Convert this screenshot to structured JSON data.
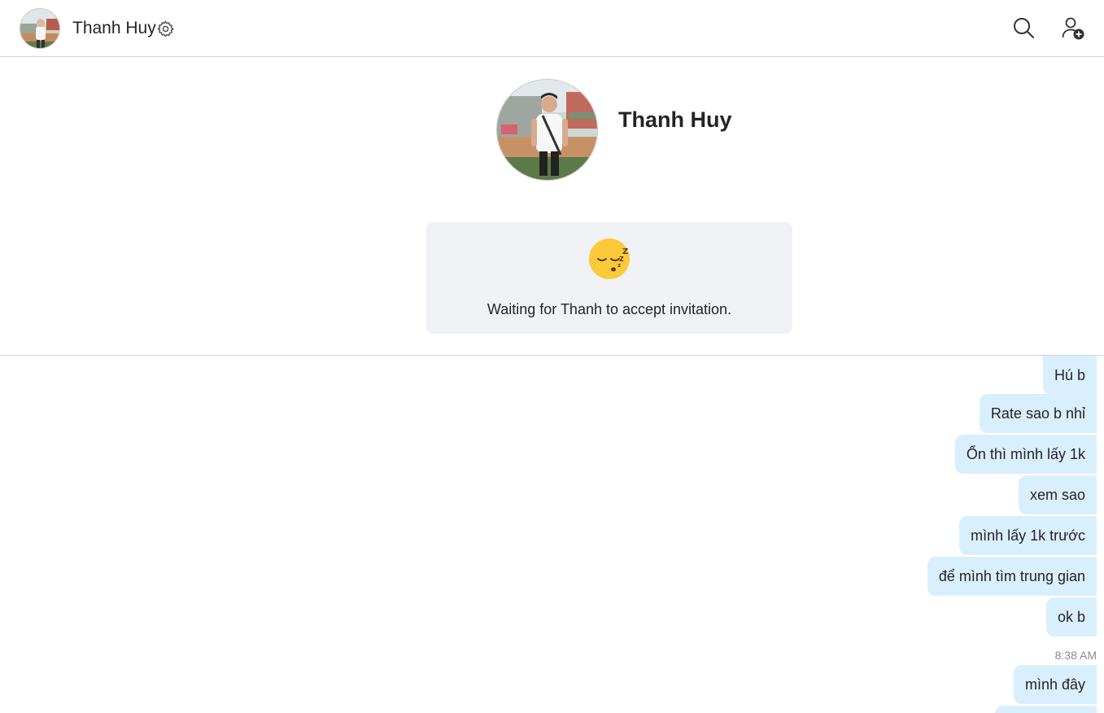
{
  "header": {
    "name": "Thanh Huy",
    "icons": [
      "avatar",
      "gear-icon",
      "search-icon",
      "add-user-icon"
    ]
  },
  "profile": {
    "name": "Thanh Huy"
  },
  "invite": {
    "emoji": "sleeping-face-icon",
    "text": "Waiting for Thanh to accept invitation."
  },
  "messages": [
    "Hú b",
    "Rate sao b nhỉ",
    "Ổn thì mình lấy 1k",
    "xem sao",
    "mình lấy 1k trước",
    "để mình tìm trung gian",
    "ok b"
  ],
  "timestamp": "8:38 AM",
  "last_message": "mình đây",
  "colors": {
    "bubble": "#d9effd",
    "card": "#f0f2f5",
    "divider": "#d6d6d6"
  }
}
